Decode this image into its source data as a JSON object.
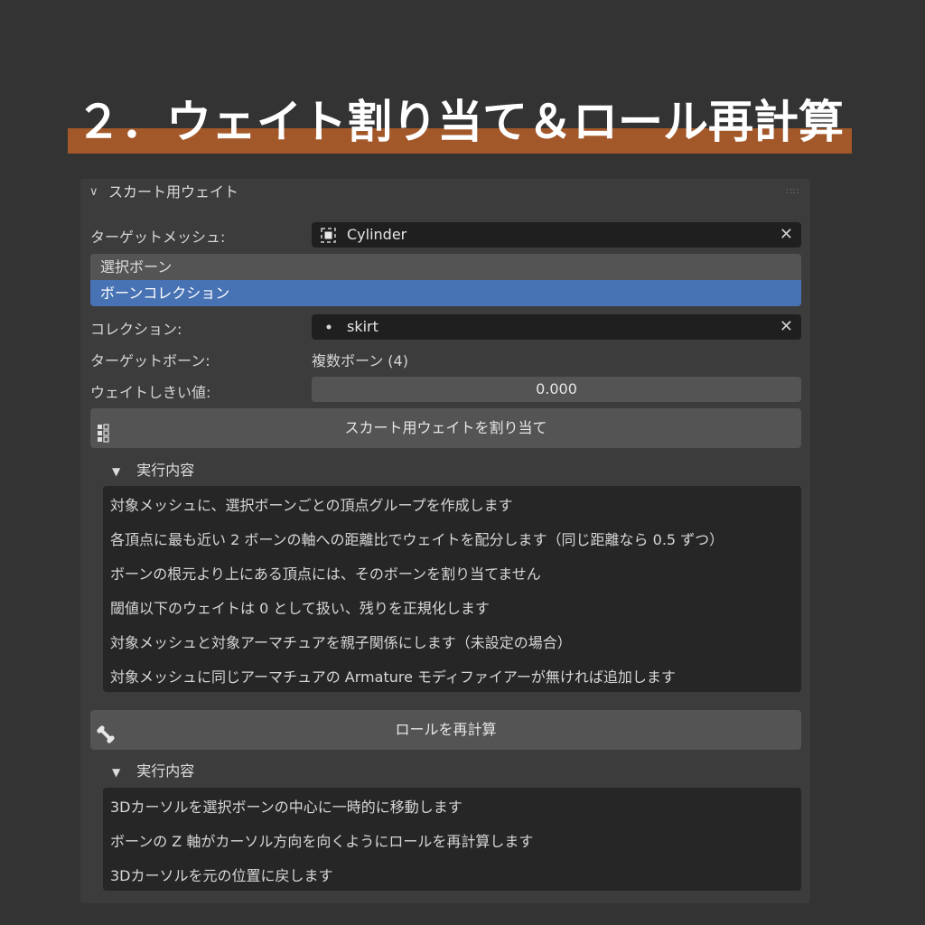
{
  "title": "２．ウェイト割り当て＆ロール再計算",
  "colors": {
    "accent": "#a3582a",
    "selected": "#4772b3"
  },
  "panel": {
    "header": "スカート用ウェイト",
    "target_mesh": {
      "label": "ターゲットメッシュ:",
      "value": "Cylinder",
      "icon": "mesh-object-icon"
    },
    "mode_options": [
      {
        "label": "選択ボーン",
        "selected": false
      },
      {
        "label": "ボーンコレクション",
        "selected": true
      }
    ],
    "collection": {
      "label": "コレクション:",
      "value": "skirt",
      "icon": "dot-icon"
    },
    "target_bone": {
      "label": "ターゲットボーン:",
      "value": "複数ボーン (4)"
    },
    "weight_threshold": {
      "label": "ウェイトしきい値:",
      "value": "0.000"
    },
    "assign_button": {
      "label": "スカート用ウェイトを割り当て",
      "icon": "vertex-groups-icon"
    },
    "assign_details": {
      "title": "実行内容",
      "lines": [
        "対象メッシュに、選択ボーンごとの頂点グループを作成します",
        "各頂点に最も近い 2 ボーンの軸への距離比でウェイトを配分します（同じ距離なら 0.5 ずつ）",
        "ボーンの根元より上にある頂点には、そのボーンを割り当てません",
        "閾値以下のウェイトは 0 として扱い、残りを正規化します",
        "対象メッシュと対象アーマチュアを親子関係にします（未設定の場合）",
        "対象メッシュに同じアーマチュアの Armature モディファイアーが無ければ追加します"
      ]
    },
    "roll_button": {
      "label": "ロールを再計算",
      "icon": "bone-icon"
    },
    "roll_details": {
      "title": "実行内容",
      "lines": [
        "3Dカーソルを選択ボーンの中心に一時的に移動します",
        "ボーンの Z 軸がカーソル方向を向くようにロールを再計算します",
        "3Dカーソルを元の位置に戻します"
      ]
    }
  }
}
